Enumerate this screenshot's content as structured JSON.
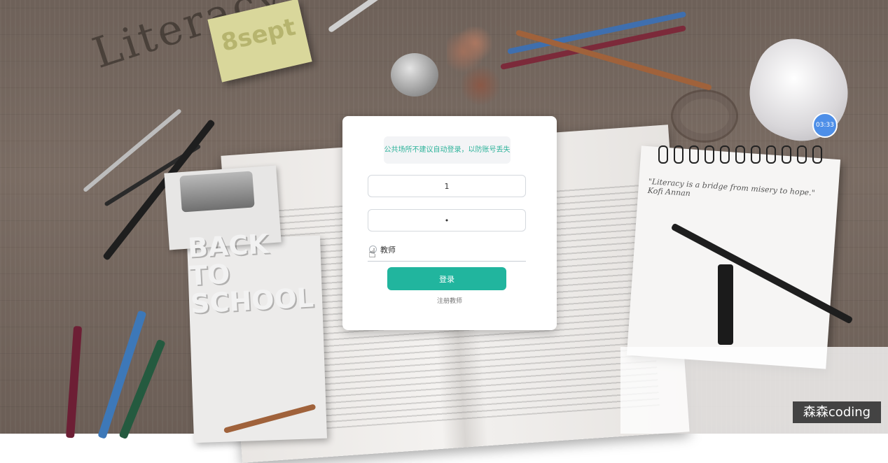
{
  "background": {
    "doodle_text": "Literacy",
    "sticky_note_text": "8sept",
    "school_text_lines": [
      "BACK",
      "TO",
      "SCHOOL"
    ],
    "notepad_text": "\"Literacy is a bridge from misery to hope.\" Kofi Annan"
  },
  "login": {
    "notice": "公共场所不建议自动登录，以防账号丢失",
    "username_value": "1",
    "password_value": "•",
    "role_label": "教师",
    "login_button": "登录",
    "register_link": "注册教师"
  },
  "timer": {
    "value": "03:33"
  },
  "watermark": {
    "label": "森森coding"
  },
  "colors": {
    "accent": "#21b59e",
    "notice_text": "#2fb39b",
    "timer_bg": "#4e8fe8"
  }
}
